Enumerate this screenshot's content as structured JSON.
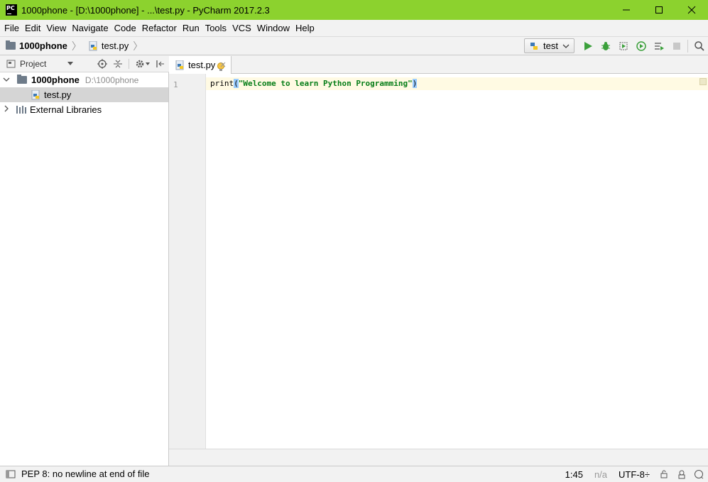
{
  "window": {
    "title": "1000phone - [D:\\1000phone] - ...\\test.py - PyCharm 2017.2.3",
    "app_icon_text": "PC",
    "accent_color": "#8cd22e"
  },
  "menu": [
    "File",
    "Edit",
    "View",
    "Navigate",
    "Code",
    "Refactor",
    "Run",
    "Tools",
    "VCS",
    "Window",
    "Help"
  ],
  "breadcrumb": {
    "project": "1000phone",
    "file": "test.py"
  },
  "run_config": {
    "label": "test"
  },
  "project_panel": {
    "title": "Project",
    "root_name": "1000phone",
    "root_path": "D:\\1000phone",
    "file": "test.py",
    "external": "External Libraries"
  },
  "editor": {
    "tab_label": "test.py",
    "line_number": "1",
    "code_prefix": "print",
    "code_open": "(",
    "code_string": "\"Welcome to learn Python Programming\"",
    "code_close": ")"
  },
  "status": {
    "message": "PEP 8: no newline at end of file",
    "position": "1:45",
    "line_sep": "n/a",
    "encoding": "UTF-8÷"
  }
}
